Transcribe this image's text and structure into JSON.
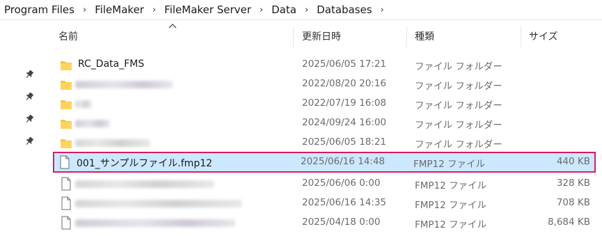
{
  "breadcrumb": [
    "Program Files",
    "FileMaker",
    "FileMaker Server",
    "Data",
    "Databases"
  ],
  "columns": {
    "name": "名前",
    "date": "更新日時",
    "type": "種類",
    "size": "サイズ"
  },
  "rows": [
    {
      "icon": "folder-icon",
      "name": "RC_Data_FMS",
      "date": "2025/06/05 17:21",
      "type": "ファイル フォルダー",
      "size": "",
      "redacted": false,
      "selected": false
    },
    {
      "icon": "folder-icon",
      "name": "",
      "date": "2022/08/20 20:16",
      "type": "ファイル フォルダー",
      "size": "",
      "redacted": true,
      "selected": false
    },
    {
      "icon": "folder-icon",
      "name": "",
      "date": "2022/07/19 16:08",
      "type": "ファイル フォルダー",
      "size": "",
      "redacted": true,
      "selected": false
    },
    {
      "icon": "folder-icon",
      "name": "",
      "date": "2024/09/24 16:00",
      "type": "ファイル フォルダー",
      "size": "",
      "redacted": true,
      "selected": false
    },
    {
      "icon": "folder-icon",
      "name": "",
      "date": "2025/06/05 18:21",
      "type": "ファイル フォルダー",
      "size": "",
      "redacted": true,
      "selected": false
    },
    {
      "icon": "file-icon",
      "name": "001_サンプルファイル.fmp12",
      "date": "2025/06/16 14:48",
      "type": "FMP12 ファイル",
      "size": "440 KB",
      "redacted": false,
      "selected": true
    },
    {
      "icon": "file-icon",
      "name": "",
      "date": "2025/06/06 0:00",
      "type": "FMP12 ファイル",
      "size": "328 KB",
      "redacted": true,
      "selected": false
    },
    {
      "icon": "file-icon",
      "name": "",
      "date": "2025/06/16 14:35",
      "type": "FMP12 ファイル",
      "size": "708 KB",
      "redacted": true,
      "selected": false
    },
    {
      "icon": "file-icon",
      "name": "",
      "date": "2025/04/18 0:00",
      "type": "FMP12 ファイル",
      "size": "8,684 KB",
      "redacted": true,
      "selected": false
    }
  ],
  "pins": [
    "pin-icon",
    "pin-icon",
    "pin-icon",
    "pin-icon"
  ],
  "colors": {
    "selection_bg": "#cce8ff",
    "highlight_border": "#d81b60",
    "folder": "#f5c542"
  }
}
